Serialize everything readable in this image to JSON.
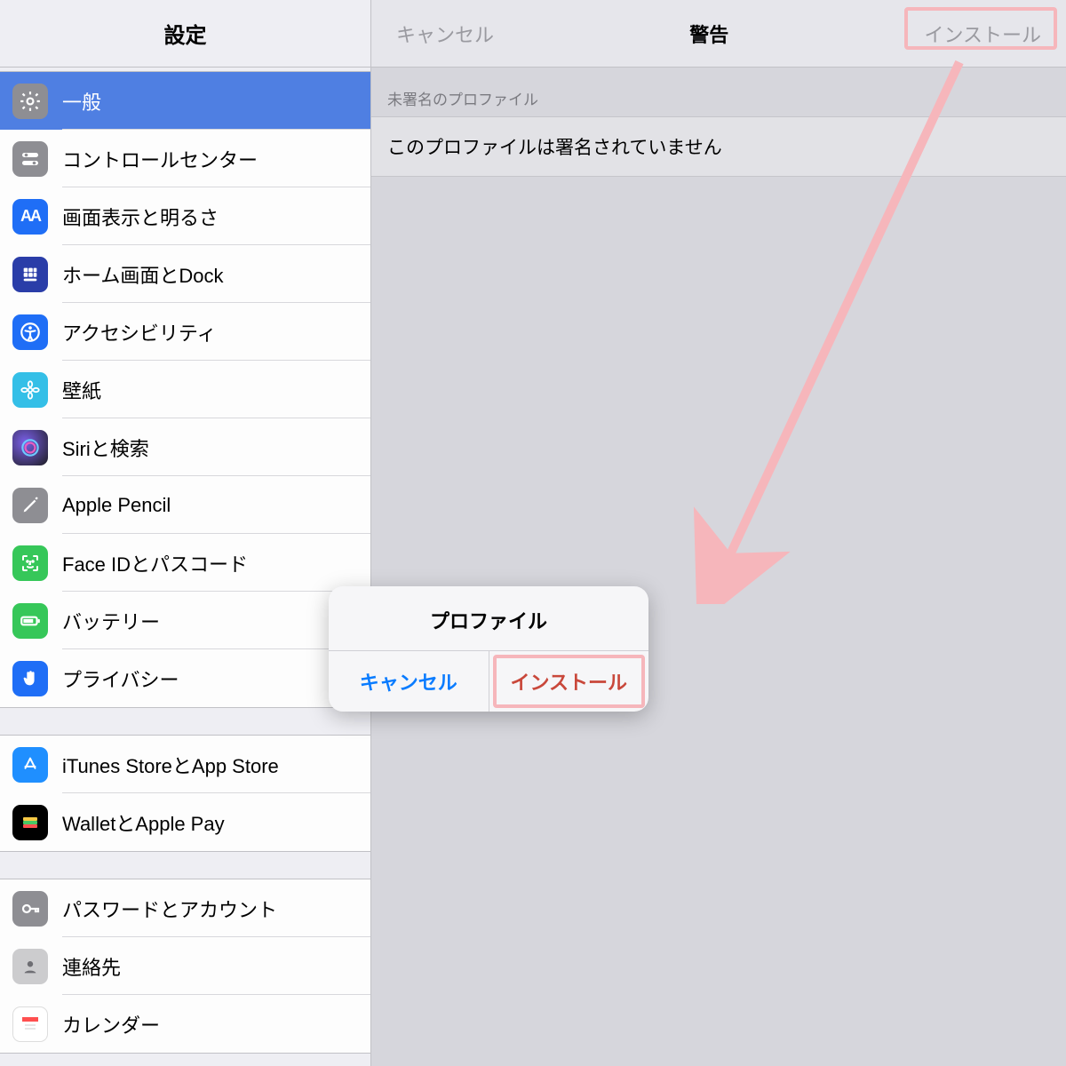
{
  "sidebar": {
    "title": "設定",
    "groups": [
      {
        "items": [
          {
            "id": "general",
            "label": "一般",
            "selected": true
          },
          {
            "id": "control",
            "label": "コントロールセンター"
          },
          {
            "id": "display",
            "label": "画面表示と明るさ"
          },
          {
            "id": "home",
            "label": "ホーム画面とDock"
          },
          {
            "id": "accessibility",
            "label": "アクセシビリティ"
          },
          {
            "id": "wallpaper",
            "label": "壁紙"
          },
          {
            "id": "siri",
            "label": "Siriと検索"
          },
          {
            "id": "pencil",
            "label": "Apple Pencil"
          },
          {
            "id": "faceid",
            "label": "Face IDとパスコード"
          },
          {
            "id": "battery",
            "label": "バッテリー"
          },
          {
            "id": "privacy",
            "label": "プライバシー"
          }
        ]
      },
      {
        "items": [
          {
            "id": "itunes",
            "label": "iTunes StoreとApp Store"
          },
          {
            "id": "wallet",
            "label": "WalletとApple Pay"
          }
        ]
      },
      {
        "items": [
          {
            "id": "passwords",
            "label": "パスワードとアカウント"
          },
          {
            "id": "contacts",
            "label": "連絡先"
          },
          {
            "id": "calendar",
            "label": "カレンダー"
          }
        ]
      }
    ]
  },
  "detail": {
    "cancel": "キャンセル",
    "title": "警告",
    "install": "インストール",
    "section_label": "未署名のプロファイル",
    "row_text": "このプロファイルは署名されていません"
  },
  "popover": {
    "title": "プロファイル",
    "cancel": "キャンセル",
    "install": "インストール"
  }
}
